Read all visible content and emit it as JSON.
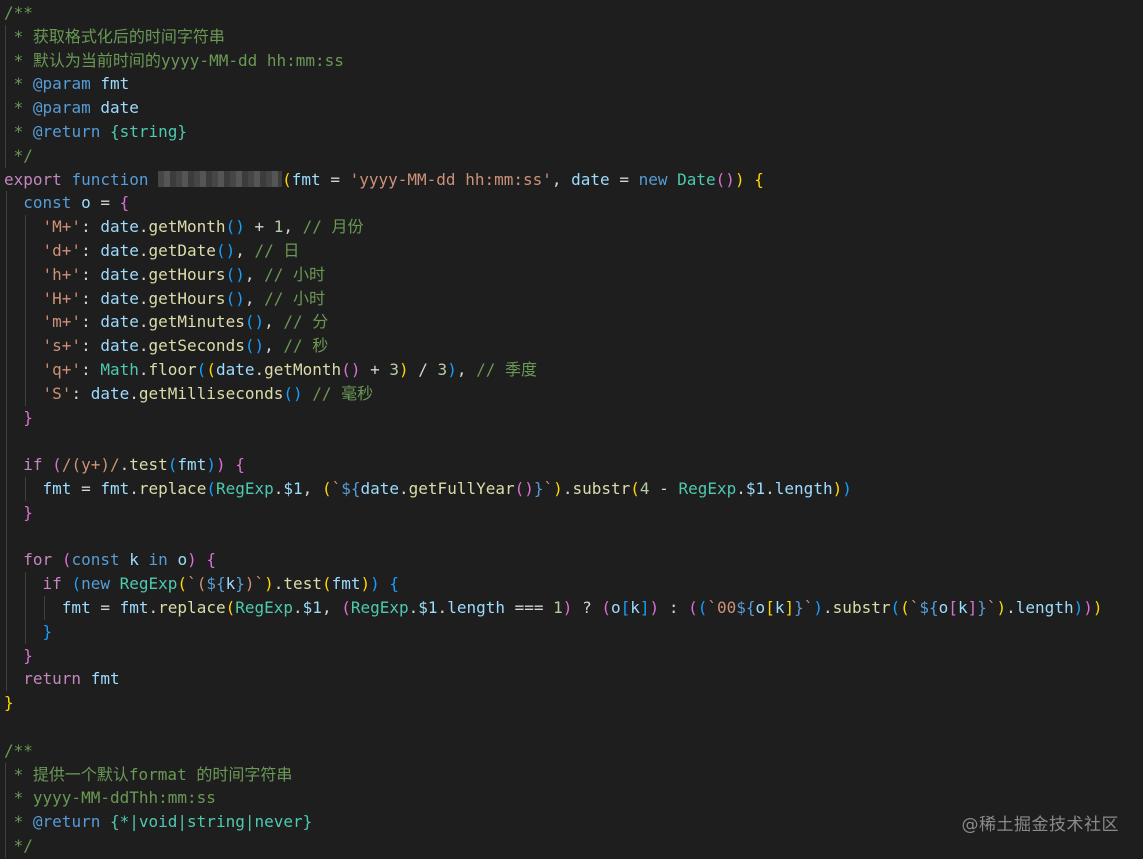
{
  "watermark": "@稀土掘金技术社区",
  "colors": {
    "comment": "#6a9955",
    "keyword": "#569cd6",
    "control": "#c586c0",
    "variable": "#9cdcfe",
    "function": "#dcdcaa",
    "string": "#ce9178",
    "number": "#b5cea8",
    "type": "#4ec9b0",
    "plain": "#d4d4d4",
    "bracket1": "#ffd700",
    "bracket2": "#da70d6",
    "bracket3": "#179fff",
    "background": "#1e1e1e"
  },
  "lines": [
    [
      [
        "/**",
        "comment"
      ]
    ],
    [
      [
        " * 获取格式化后的时间字符串",
        "comment"
      ]
    ],
    [
      [
        " * 默认为当前时间的yyyy-MM-dd hh:mm:ss",
        "comment"
      ]
    ],
    [
      [
        " * ",
        "comment"
      ],
      [
        "@param",
        "keyword"
      ],
      [
        " ",
        "comment"
      ],
      [
        "fmt",
        "variable"
      ]
    ],
    [
      [
        " * ",
        "comment"
      ],
      [
        "@param",
        "keyword"
      ],
      [
        " ",
        "comment"
      ],
      [
        "date",
        "variable"
      ]
    ],
    [
      [
        " * ",
        "comment"
      ],
      [
        "@return",
        "keyword"
      ],
      [
        " {string}",
        "type"
      ]
    ],
    [
      [
        " */",
        "comment"
      ]
    ],
    [
      [
        "export",
        "control"
      ],
      [
        " ",
        "plain"
      ],
      [
        "function",
        "keyword"
      ],
      [
        " ",
        "plain"
      ],
      [
        "",
        "redact"
      ],
      [
        "(",
        "bracket1"
      ],
      [
        "fmt",
        "variable"
      ],
      [
        " = ",
        "plain"
      ],
      [
        "'yyyy-MM-dd hh:mm:ss'",
        "string"
      ],
      [
        ", ",
        "plain"
      ],
      [
        "date",
        "variable"
      ],
      [
        " = ",
        "plain"
      ],
      [
        "new",
        "keyword"
      ],
      [
        " ",
        "plain"
      ],
      [
        "Date",
        "type"
      ],
      [
        "()",
        "bracket2"
      ],
      [
        ")",
        "bracket1"
      ],
      [
        " ",
        "plain"
      ],
      [
        "{",
        "bracket1"
      ]
    ],
    [
      [
        "  ",
        "plain"
      ],
      [
        "const",
        "keyword"
      ],
      [
        " ",
        "plain"
      ],
      [
        "o",
        "variable"
      ],
      [
        " = ",
        "plain"
      ],
      [
        "{",
        "bracket2"
      ]
    ],
    [
      [
        "    ",
        "plain"
      ],
      [
        "'M+'",
        "string"
      ],
      [
        ": ",
        "plain"
      ],
      [
        "date",
        "variable"
      ],
      [
        ".",
        "plain"
      ],
      [
        "getMonth",
        "function"
      ],
      [
        "()",
        "bracket3"
      ],
      [
        " + ",
        "plain"
      ],
      [
        "1",
        "number"
      ],
      [
        ", ",
        "plain"
      ],
      [
        "// 月份",
        "comment"
      ]
    ],
    [
      [
        "    ",
        "plain"
      ],
      [
        "'d+'",
        "string"
      ],
      [
        ": ",
        "plain"
      ],
      [
        "date",
        "variable"
      ],
      [
        ".",
        "plain"
      ],
      [
        "getDate",
        "function"
      ],
      [
        "()",
        "bracket3"
      ],
      [
        ", ",
        "plain"
      ],
      [
        "// 日",
        "comment"
      ]
    ],
    [
      [
        "    ",
        "plain"
      ],
      [
        "'h+'",
        "string"
      ],
      [
        ": ",
        "plain"
      ],
      [
        "date",
        "variable"
      ],
      [
        ".",
        "plain"
      ],
      [
        "getHours",
        "function"
      ],
      [
        "()",
        "bracket3"
      ],
      [
        ", ",
        "plain"
      ],
      [
        "// 小时",
        "comment"
      ]
    ],
    [
      [
        "    ",
        "plain"
      ],
      [
        "'H+'",
        "string"
      ],
      [
        ": ",
        "plain"
      ],
      [
        "date",
        "variable"
      ],
      [
        ".",
        "plain"
      ],
      [
        "getHours",
        "function"
      ],
      [
        "()",
        "bracket3"
      ],
      [
        ", ",
        "plain"
      ],
      [
        "// 小时",
        "comment"
      ]
    ],
    [
      [
        "    ",
        "plain"
      ],
      [
        "'m+'",
        "string"
      ],
      [
        ": ",
        "plain"
      ],
      [
        "date",
        "variable"
      ],
      [
        ".",
        "plain"
      ],
      [
        "getMinutes",
        "function"
      ],
      [
        "()",
        "bracket3"
      ],
      [
        ", ",
        "plain"
      ],
      [
        "// 分",
        "comment"
      ]
    ],
    [
      [
        "    ",
        "plain"
      ],
      [
        "'s+'",
        "string"
      ],
      [
        ": ",
        "plain"
      ],
      [
        "date",
        "variable"
      ],
      [
        ".",
        "plain"
      ],
      [
        "getSeconds",
        "function"
      ],
      [
        "()",
        "bracket3"
      ],
      [
        ", ",
        "plain"
      ],
      [
        "// 秒",
        "comment"
      ]
    ],
    [
      [
        "    ",
        "plain"
      ],
      [
        "'q+'",
        "string"
      ],
      [
        ": ",
        "plain"
      ],
      [
        "Math",
        "type"
      ],
      [
        ".",
        "plain"
      ],
      [
        "floor",
        "function"
      ],
      [
        "(",
        "bracket3"
      ],
      [
        "(",
        "bracket1"
      ],
      [
        "date",
        "variable"
      ],
      [
        ".",
        "plain"
      ],
      [
        "getMonth",
        "function"
      ],
      [
        "()",
        "bracket2"
      ],
      [
        " + ",
        "plain"
      ],
      [
        "3",
        "number"
      ],
      [
        ")",
        "bracket1"
      ],
      [
        " / ",
        "plain"
      ],
      [
        "3",
        "number"
      ],
      [
        ")",
        "bracket3"
      ],
      [
        ", ",
        "plain"
      ],
      [
        "// 季度",
        "comment"
      ]
    ],
    [
      [
        "    ",
        "plain"
      ],
      [
        "'S'",
        "string"
      ],
      [
        ": ",
        "plain"
      ],
      [
        "date",
        "variable"
      ],
      [
        ".",
        "plain"
      ],
      [
        "getMilliseconds",
        "function"
      ],
      [
        "()",
        "bracket3"
      ],
      [
        " ",
        "plain"
      ],
      [
        "// 毫秒",
        "comment"
      ]
    ],
    [
      [
        "  ",
        "plain"
      ],
      [
        "}",
        "bracket2"
      ]
    ],
    [],
    [
      [
        "  ",
        "plain"
      ],
      [
        "if",
        "control"
      ],
      [
        " ",
        "plain"
      ],
      [
        "(",
        "bracket2"
      ],
      [
        "/(y+)/",
        "string"
      ],
      [
        ".",
        "plain"
      ],
      [
        "test",
        "function"
      ],
      [
        "(",
        "bracket3"
      ],
      [
        "fmt",
        "variable"
      ],
      [
        ")",
        "bracket3"
      ],
      [
        ")",
        "bracket2"
      ],
      [
        " ",
        "plain"
      ],
      [
        "{",
        "bracket2"
      ]
    ],
    [
      [
        "    ",
        "plain"
      ],
      [
        "fmt",
        "variable"
      ],
      [
        " = ",
        "plain"
      ],
      [
        "fmt",
        "variable"
      ],
      [
        ".",
        "plain"
      ],
      [
        "replace",
        "function"
      ],
      [
        "(",
        "bracket3"
      ],
      [
        "RegExp",
        "type"
      ],
      [
        ".",
        "plain"
      ],
      [
        "$1",
        "variable"
      ],
      [
        ", ",
        "plain"
      ],
      [
        "(",
        "bracket1"
      ],
      [
        "`",
        "string"
      ],
      [
        "${",
        "keyword"
      ],
      [
        "date",
        "variable"
      ],
      [
        ".",
        "plain"
      ],
      [
        "getFullYear",
        "function"
      ],
      [
        "()",
        "bracket2"
      ],
      [
        "}",
        "keyword"
      ],
      [
        "`",
        "string"
      ],
      [
        ")",
        "bracket1"
      ],
      [
        ".",
        "plain"
      ],
      [
        "substr",
        "function"
      ],
      [
        "(",
        "bracket1"
      ],
      [
        "4",
        "number"
      ],
      [
        " - ",
        "plain"
      ],
      [
        "RegExp",
        "type"
      ],
      [
        ".",
        "plain"
      ],
      [
        "$1",
        "variable"
      ],
      [
        ".",
        "plain"
      ],
      [
        "length",
        "variable"
      ],
      [
        ")",
        "bracket1"
      ],
      [
        ")",
        "bracket3"
      ]
    ],
    [
      [
        "  ",
        "plain"
      ],
      [
        "}",
        "bracket2"
      ]
    ],
    [],
    [
      [
        "  ",
        "plain"
      ],
      [
        "for",
        "control"
      ],
      [
        " ",
        "plain"
      ],
      [
        "(",
        "bracket2"
      ],
      [
        "const",
        "keyword"
      ],
      [
        " ",
        "plain"
      ],
      [
        "k",
        "variable"
      ],
      [
        " ",
        "plain"
      ],
      [
        "in",
        "keyword"
      ],
      [
        " ",
        "plain"
      ],
      [
        "o",
        "variable"
      ],
      [
        ")",
        "bracket2"
      ],
      [
        " ",
        "plain"
      ],
      [
        "{",
        "bracket2"
      ]
    ],
    [
      [
        "    ",
        "plain"
      ],
      [
        "if",
        "control"
      ],
      [
        " ",
        "plain"
      ],
      [
        "(",
        "bracket3"
      ],
      [
        "new",
        "keyword"
      ],
      [
        " ",
        "plain"
      ],
      [
        "RegExp",
        "type"
      ],
      [
        "(",
        "bracket1"
      ],
      [
        "`(",
        "string"
      ],
      [
        "${",
        "keyword"
      ],
      [
        "k",
        "variable"
      ],
      [
        "}",
        "keyword"
      ],
      [
        ")`",
        "string"
      ],
      [
        ")",
        "bracket1"
      ],
      [
        ".",
        "plain"
      ],
      [
        "test",
        "function"
      ],
      [
        "(",
        "bracket1"
      ],
      [
        "fmt",
        "variable"
      ],
      [
        ")",
        "bracket1"
      ],
      [
        ")",
        "bracket3"
      ],
      [
        " ",
        "plain"
      ],
      [
        "{",
        "bracket3"
      ]
    ],
    [
      [
        "      ",
        "plain"
      ],
      [
        "fmt",
        "variable"
      ],
      [
        " = ",
        "plain"
      ],
      [
        "fmt",
        "variable"
      ],
      [
        ".",
        "plain"
      ],
      [
        "replace",
        "function"
      ],
      [
        "(",
        "bracket1"
      ],
      [
        "RegExp",
        "type"
      ],
      [
        ".",
        "plain"
      ],
      [
        "$1",
        "variable"
      ],
      [
        ", ",
        "plain"
      ],
      [
        "(",
        "bracket2"
      ],
      [
        "RegExp",
        "type"
      ],
      [
        ".",
        "plain"
      ],
      [
        "$1",
        "variable"
      ],
      [
        ".",
        "plain"
      ],
      [
        "length",
        "variable"
      ],
      [
        " === ",
        "plain"
      ],
      [
        "1",
        "number"
      ],
      [
        ")",
        "bracket2"
      ],
      [
        " ? ",
        "plain"
      ],
      [
        "(",
        "bracket2"
      ],
      [
        "o",
        "variable"
      ],
      [
        "[",
        "bracket3"
      ],
      [
        "k",
        "variable"
      ],
      [
        "]",
        "bracket3"
      ],
      [
        ")",
        "bracket2"
      ],
      [
        " : ",
        "plain"
      ],
      [
        "(",
        "bracket2"
      ],
      [
        "(",
        "bracket3"
      ],
      [
        "`00",
        "string"
      ],
      [
        "${",
        "keyword"
      ],
      [
        "o",
        "variable"
      ],
      [
        "[",
        "bracket1"
      ],
      [
        "k",
        "variable"
      ],
      [
        "]",
        "bracket1"
      ],
      [
        "}",
        "keyword"
      ],
      [
        "`",
        "string"
      ],
      [
        ")",
        "bracket3"
      ],
      [
        ".",
        "plain"
      ],
      [
        "substr",
        "function"
      ],
      [
        "(",
        "bracket3"
      ],
      [
        "(",
        "bracket1"
      ],
      [
        "`",
        "string"
      ],
      [
        "${",
        "keyword"
      ],
      [
        "o",
        "variable"
      ],
      [
        "[",
        "bracket2"
      ],
      [
        "k",
        "variable"
      ],
      [
        "]",
        "bracket2"
      ],
      [
        "}",
        "keyword"
      ],
      [
        "`",
        "string"
      ],
      [
        ")",
        "bracket1"
      ],
      [
        ".",
        "plain"
      ],
      [
        "length",
        "variable"
      ],
      [
        ")",
        "bracket3"
      ],
      [
        ")",
        "bracket2"
      ],
      [
        ")",
        "bracket1"
      ]
    ],
    [
      [
        "    ",
        "plain"
      ],
      [
        "}",
        "bracket3"
      ]
    ],
    [
      [
        "  ",
        "plain"
      ],
      [
        "}",
        "bracket2"
      ]
    ],
    [
      [
        "  ",
        "plain"
      ],
      [
        "return",
        "control"
      ],
      [
        " ",
        "plain"
      ],
      [
        "fmt",
        "variable"
      ]
    ],
    [
      [
        "}",
        "bracket1"
      ]
    ],
    [],
    [
      [
        "/**",
        "comment"
      ]
    ],
    [
      [
        " * 提供一个默认format 的时间字符串",
        "comment"
      ]
    ],
    [
      [
        " * yyyy-MM-ddThh:mm:ss",
        "comment"
      ]
    ],
    [
      [
        " * ",
        "comment"
      ],
      [
        "@return",
        "keyword"
      ],
      [
        " {*|void|string|never}",
        "type"
      ]
    ],
    [
      [
        " */",
        "comment"
      ]
    ]
  ]
}
